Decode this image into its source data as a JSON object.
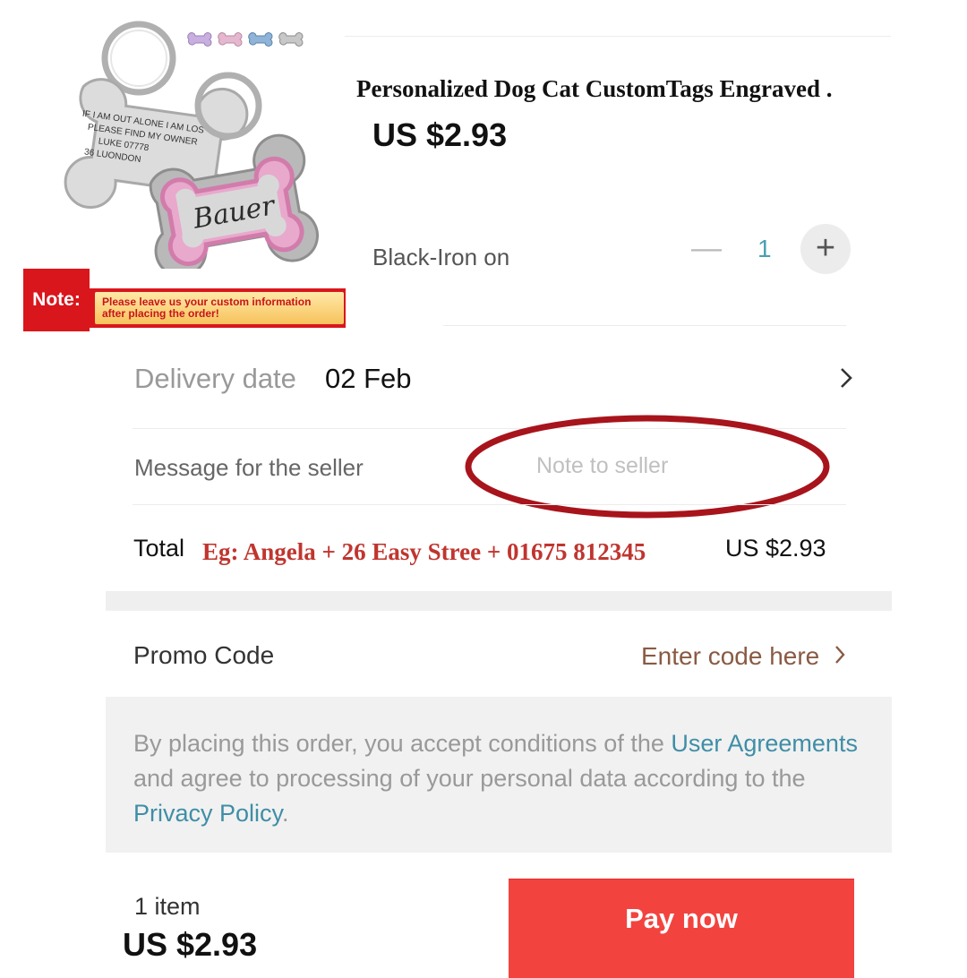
{
  "product": {
    "title": "Personalized Dog Cat CustomTags Engraved .",
    "price": "US $2.93",
    "variant": "Black-Iron on",
    "quantity": "1",
    "image": {
      "tag_plain_lines": [
        "IF I AM OUT ALONE I AM LOS",
        "PLEASE FIND MY OWNER",
        "LUKE 07778",
        "36 LUONDON"
      ],
      "tag_pink_name": "Bauer",
      "swatch_colors": [
        "#c9aee0",
        "#e6b8cf",
        "#8fb4d8",
        "#c8c8c8"
      ]
    },
    "note_banner": {
      "tag": "Note:",
      "line1": "Please leave us your custom information",
      "line2": "after placing the order!"
    }
  },
  "delivery": {
    "label": "Delivery date",
    "value": "02 Feb"
  },
  "seller_message": {
    "label": "Message for the seller",
    "placeholder": "Note to seller",
    "value": ""
  },
  "total": {
    "label": "Total",
    "example": "Eg: Angela + 26 Easy Stree + 01675 812345",
    "value": "US $2.93"
  },
  "promo": {
    "label": "Promo Code",
    "link": "Enter code here"
  },
  "agreement": {
    "part1": "By placing this order, you accept conditions of the ",
    "link1": "User Agreements",
    "part2": " and agree to processing of your personal data according to the ",
    "link2": "Privacy Policy",
    "part3": "."
  },
  "footer": {
    "item_count": "1 item",
    "price": "US $2.93",
    "pay_label": "Pay now"
  },
  "colors": {
    "accent": "#f3433f",
    "link": "#3f8ea6",
    "annotation_red": "#c0352f"
  }
}
